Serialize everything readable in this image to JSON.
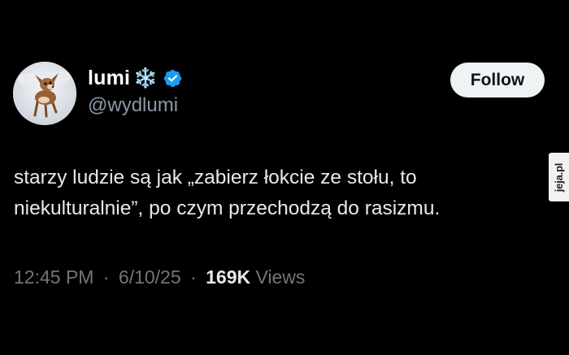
{
  "tweet": {
    "author": {
      "display_name": "lumi",
      "emoji": "❄️",
      "handle": "@wydlumi",
      "verified": true,
      "avatar_icon": "deer-fawn-avatar"
    },
    "follow_label": "Follow",
    "text_lines": [
      "starzy ludzie są jak „zabierz łokcie ze stołu, to",
      "niekulturalnie”, po czym przechodzą do rasizmu."
    ],
    "meta": {
      "time": "12:45 PM",
      "separator": "·",
      "date": "6/10/25",
      "views_count": "169K",
      "views_label": "Views"
    }
  },
  "watermark": {
    "text": "jeja.pl"
  },
  "colors": {
    "background": "#000000",
    "primary_text": "#e7e9ea",
    "secondary_text": "#71767b",
    "verified_blue": "#1d9bf0",
    "follow_button_bg": "#eff3f4"
  }
}
